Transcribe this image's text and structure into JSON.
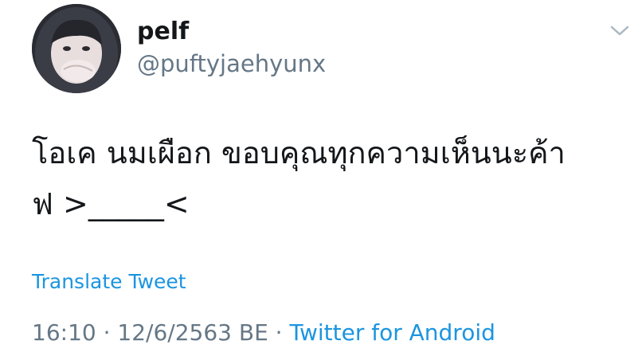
{
  "author": {
    "display_name": "pelf",
    "handle": "@puftyjaehyunx"
  },
  "tweet": {
    "text_line_1": "โอเค นมเผือก ขอบคุณทุกความเห็นนะค้า",
    "text_line_2": "ฟ >_____<"
  },
  "translate_label": "Translate Tweet",
  "meta": {
    "time": "16:10",
    "sep1": " · ",
    "date": "12/6/2563 BE",
    "sep2": " · ",
    "source": "Twitter for Android"
  },
  "icons": {
    "menu": "chevron-down-icon"
  },
  "colors": {
    "link": "#1b95e0",
    "secondary": "#657786",
    "primary_text": "#14171a"
  }
}
